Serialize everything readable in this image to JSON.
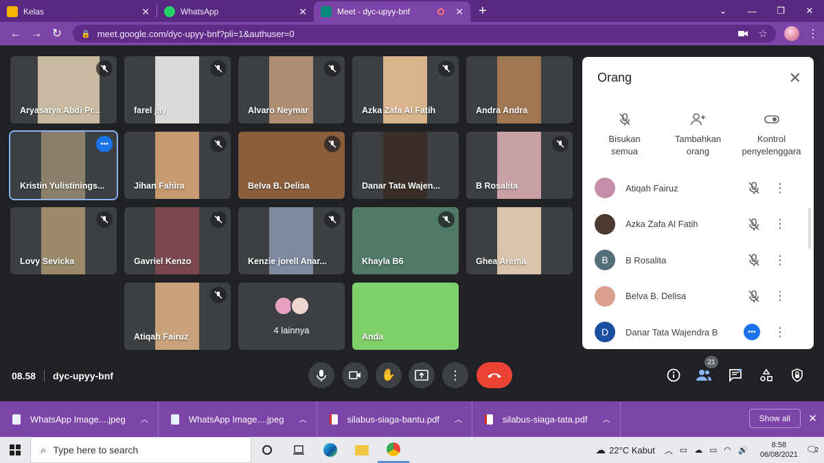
{
  "browser": {
    "tabs": [
      {
        "title": "Kelas",
        "favicon_color": "#f4b400"
      },
      {
        "title": "WhatsApp",
        "favicon_color": "#25d366"
      },
      {
        "title": "Meet - dyc-upyy-bnf",
        "favicon_color": "#00897b"
      }
    ],
    "url": "meet.google.com/dyc-upyy-bnf?pli=1&authuser=0"
  },
  "tiles": [
    {
      "name": "Aryasatya Abdi Pr...",
      "color": "#c8b9a0"
    },
    {
      "name": "farel jay",
      "color": "#d9dad7"
    },
    {
      "name": "Alvaro Neymar",
      "color": "#b08e72"
    },
    {
      "name": "Azka Zafa Al Fatih",
      "color": "#d9b38c"
    },
    {
      "name": "Andra Andra",
      "color": "#a17753"
    },
    {
      "name": "Kristin Yulistinings...",
      "color": "#8c7f6a"
    },
    {
      "name": "Jihan Fahira",
      "color": "#c79a70"
    },
    {
      "name": "Belva B. Delisa",
      "color": "#8b5e3c"
    },
    {
      "name": "Danar Tata Wajen...",
      "color": "#3a2e28"
    },
    {
      "name": "B Rosalita",
      "color": "#c99fa6"
    },
    {
      "name": "Lovy Sevicka",
      "color": "#9a8a6b"
    },
    {
      "name": "Gavriel Kenzo",
      "color": "#7a4750"
    },
    {
      "name": "Kenzie jorell Anar...",
      "color": "#7d8aa0"
    },
    {
      "name": "Khayla B6",
      "color": "#4f7a68"
    },
    {
      "name": "Ghea Arema",
      "color": "#d8c4a8"
    },
    {
      "name": "Atiqah Fairuz",
      "color": "#c9a27a"
    },
    {
      "name": "4 lainnya",
      "color": "#3c4043"
    },
    {
      "name": "Anda",
      "color": "#7fcf6a"
    }
  ],
  "panel": {
    "title": "Orang",
    "actions": [
      {
        "line1": "Bisukan",
        "line2": "semua"
      },
      {
        "line1": "Tambahkan",
        "line2": "orang"
      },
      {
        "line1": "Kontrol",
        "line2": "penyelenggara"
      }
    ],
    "people": [
      {
        "name": "Atiqah Fairuz",
        "initial": "",
        "color": "#c48da8"
      },
      {
        "name": "Azka Zafa Al Fatih",
        "initial": "",
        "color": "#4a3a30"
      },
      {
        "name": "B Rosalita",
        "initial": "B",
        "color": "#546e7a"
      },
      {
        "name": "Belva B. Delisa",
        "initial": "",
        "color": "#d9a08f"
      },
      {
        "name": "Danar Tata Wajendra B",
        "initial": "D",
        "color": "#1a4fa0"
      }
    ]
  },
  "meeting": {
    "time": "08.58",
    "code": "dyc-upyy-bnf",
    "participant_count": "21"
  },
  "downloads": {
    "items": [
      "WhatsApp Image....jpeg",
      "WhatsApp Image....jpeg",
      "silabus-siaga-bantu.pdf",
      "silabus-siaga-tata.pdf"
    ],
    "show_all": "Show all"
  },
  "taskbar": {
    "search_placeholder": "Type here to search",
    "weather": "22°C  Kabut",
    "time": "8:58",
    "date": "06/08/2021",
    "notifications": "2"
  }
}
